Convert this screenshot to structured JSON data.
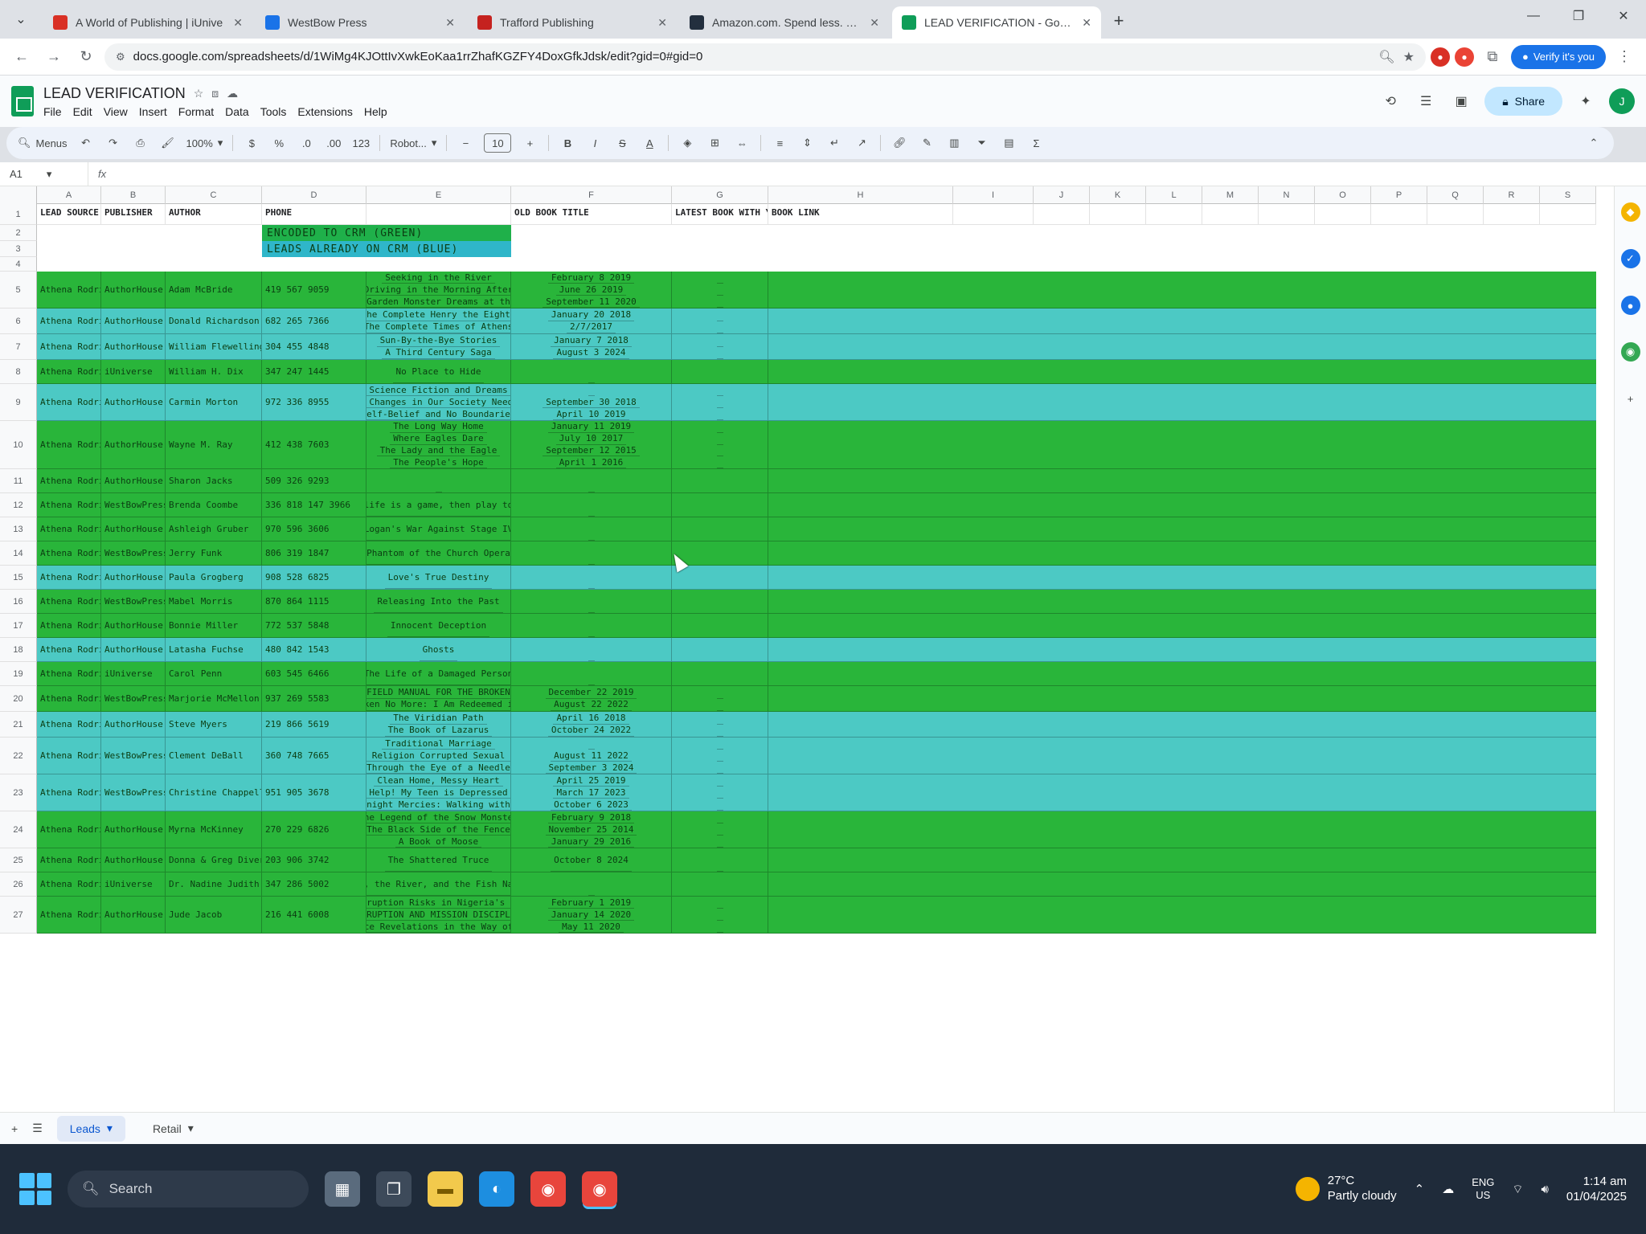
{
  "browser": {
    "tabs": [
      {
        "title": "A World of Publishing | iUnive",
        "icon": "iuniverse-favicon",
        "color": "#d93025",
        "active": false
      },
      {
        "title": "WestBow Press",
        "icon": "westbow-favicon",
        "color": "#1a73e8",
        "active": false
      },
      {
        "title": "Trafford Publishing",
        "icon": "trafford-favicon",
        "color": "#c5221f",
        "active": false
      },
      {
        "title": "Amazon.com. Spend less. Smi",
        "icon": "amazon-favicon",
        "color": "#232f3e",
        "active": false
      },
      {
        "title": "LEAD VERIFICATION - Google",
        "icon": "sheets-favicon",
        "color": "#0f9d58",
        "active": true
      }
    ],
    "url": "docs.google.com/spreadsheets/d/1WiMg4KJOttIvXwkEoKaa1rrZhafKGZFY4DoxGfkJdsk/edit?gid=0#gid=0",
    "verify_label": "Verify it's you"
  },
  "sheets": {
    "doc_title": "LEAD VERIFICATION",
    "menu": [
      "File",
      "Edit",
      "View",
      "Insert",
      "Format",
      "Data",
      "Tools",
      "Extensions",
      "Help"
    ],
    "share_label": "Share",
    "avatar_letter": "J"
  },
  "toolbar": {
    "search": "Menus",
    "zoom": "100%",
    "currency": "$",
    "percent": "%",
    "decimal_dec": ".0",
    "decimal_inc": ".00",
    "format_123": "123",
    "font": "Robot...",
    "font_size": "10"
  },
  "formula_bar": {
    "cell_ref": "A1",
    "fx": "fx"
  },
  "grid": {
    "column_letters": [
      "A",
      "B",
      "C",
      "D",
      "E",
      "F",
      "G",
      "H",
      "I",
      "J",
      "K",
      "L",
      "M",
      "N",
      "O",
      "P",
      "Q",
      "R",
      "S"
    ],
    "headers": {
      "lead_source": "LEAD SOURCE",
      "publisher": "PUBLISHER",
      "author": "AUTHOR",
      "phone": "PHONE",
      "old_book_title": "OLD BOOK TITLE",
      "latest_book": "LATEST BOOK WITH YEAR",
      "book_link": "BOOK LINK"
    },
    "legend": [
      "ENCODED TO CRM (GREEN)",
      "LEADS ALREADY ON CRM (BLUE)"
    ],
    "colors": {
      "green": "#29b53a",
      "blue": "#4cc9c4",
      "legend_green": "#1fb04a",
      "legend_blue": "#2fb6c9"
    },
    "rows": [
      {
        "source": "Athena Rodrigu",
        "publisher": "AuthorHouse",
        "author": "Adam McBride",
        "phone": "419 567 9059",
        "color": "green",
        "titles": [
          "Seeking in the River",
          "Driving in the Morning After",
          "The Garden Monster Dreams at the Fa"
        ],
        "dates": [
          "February 8 2019",
          "June 26 2019",
          "September 11 2020"
        ],
        "links": 3
      },
      {
        "source": "Athena Rodrigu",
        "publisher": "AuthorHouse",
        "author": "Donald Richardson",
        "phone": "682 265 7366",
        "color": "blue",
        "titles": [
          "The Complete Henry the Eighth",
          "The Complete Times of Athens"
        ],
        "dates": [
          "January 20 2018",
          "2/7/2017"
        ],
        "links": 2
      },
      {
        "source": "Athena Rodrigu",
        "publisher": "AuthorHouse",
        "author": "William Flewelling",
        "phone": "304 455 4848",
        "color": "blue",
        "titles": [
          "Sun-By-the-Bye Stories",
          "A Third Century Saga"
        ],
        "dates": [
          "January 7 2018",
          "August 3 2024"
        ],
        "links": 2
      },
      {
        "source": "Athena Rodrigu",
        "publisher": "iUniverse",
        "author": "William H. Dix",
        "phone": "347 247 1445",
        "color": "green",
        "titles": [
          "No Place to Hide"
        ],
        "dates": [
          ""
        ],
        "links": 0
      },
      {
        "source": "Athena Rodrigu",
        "publisher": "AuthorHouse",
        "author": "Carmin Morton",
        "phone": "972 336 8955",
        "color": "blue",
        "titles": [
          "Science Fiction and Dreams",
          "The Changes in Our Society Need Ju",
          "Self-Belief and No Boundaries"
        ],
        "dates": [
          "",
          "September 30 2018",
          "April 10 2019"
        ],
        "links": 3
      },
      {
        "source": "Athena Rodrigu",
        "publisher": "AuthorHouse",
        "author": "Wayne M. Ray",
        "phone": "412 438 7603",
        "color": "green",
        "titles": [
          "The Long Way Home",
          "Where Eagles Dare",
          "The Lady and the Eagle",
          "The People's Hope"
        ],
        "dates": [
          "January 11 2019",
          "July 10 2017",
          "September 12 2015",
          "April 1 2016"
        ],
        "links": 4
      },
      {
        "source": "Athena Rodrigu",
        "publisher": "AuthorHouse",
        "author": "Sharon Jacks",
        "phone": "509 326 9293",
        "color": "green",
        "titles": [
          ""
        ],
        "dates": [
          ""
        ],
        "links": 0
      },
      {
        "source": "Athena Rodrigu",
        "publisher": "WestBowPress",
        "author": "Brenda Coombe",
        "phone": "336 818 147 3966",
        "color": "green",
        "titles": [
          "If life is a game, then play to wi"
        ],
        "dates": [
          ""
        ],
        "links": 0
      },
      {
        "source": "Athena Rodrigu",
        "publisher": "AuthorHouse",
        "author": "Ashleigh Gruber",
        "phone": "970 596 3606",
        "color": "green",
        "titles": [
          "Logan's War Against Stage IV"
        ],
        "dates": [
          ""
        ],
        "links": 0
      },
      {
        "source": "Athena Rodrigu",
        "publisher": "WestBowPress",
        "author": "Jerry Funk",
        "phone": "806 319 1847",
        "color": "green",
        "titles": [
          "Phantom of the Church Opera"
        ],
        "dates": [
          ""
        ],
        "links": 0
      },
      {
        "source": "Athena Rodrigu",
        "publisher": "AuthorHouse",
        "author": "Paula Grogberg",
        "phone": "908 528 6825",
        "color": "blue",
        "titles": [
          "Love's True Destiny"
        ],
        "dates": [
          ""
        ],
        "links": 0
      },
      {
        "source": "Athena Rodrigu",
        "publisher": "WestBowPress",
        "author": "Mabel Morris",
        "phone": "870 864 1115",
        "color": "green",
        "titles": [
          "Releasing Into the Past"
        ],
        "dates": [
          ""
        ],
        "links": 0
      },
      {
        "source": "Athena Rodrigu",
        "publisher": "AuthorHouse",
        "author": "Bonnie Miller",
        "phone": "772 537 5848",
        "color": "green",
        "titles": [
          "Innocent Deception"
        ],
        "dates": [
          ""
        ],
        "links": 0
      },
      {
        "source": "Athena Rodrigu",
        "publisher": "AuthorHouse",
        "author": "Latasha Fuchse",
        "phone": "480 842 1543",
        "color": "blue",
        "titles": [
          "Ghosts"
        ],
        "dates": [
          ""
        ],
        "links": 0
      },
      {
        "source": "Athena Rodrigu",
        "publisher": "iUniverse",
        "author": "Carol Penn",
        "phone": "603 545 6466",
        "color": "green",
        "titles": [
          "The Life of a Damaged Person"
        ],
        "dates": [
          ""
        ],
        "links": 0
      },
      {
        "source": "Athena Rodrigu",
        "publisher": "WestBowPress",
        "author": "Marjorie McMellon",
        "phone": "937 269 5583",
        "color": "green",
        "titles": [
          "FIELD MANUAL FOR THE BROKEN",
          "Broken No More: I Am Redeemed in C"
        ],
        "dates": [
          "December 22 2019",
          "August 22 2022"
        ],
        "links": 2
      },
      {
        "source": "Athena Rodrigu",
        "publisher": "AuthorHouse",
        "author": "Steve Myers",
        "phone": "219 866 5619",
        "color": "blue",
        "titles": [
          "The Viridian Path",
          "The Book of Lazarus"
        ],
        "dates": [
          "April 16 2018",
          "October 24 2022"
        ],
        "links": 2
      },
      {
        "source": "Athena Rodrigu",
        "publisher": "WestBowPress",
        "author": "Clement DeBall",
        "phone": "360 748 7665",
        "color": "blue",
        "titles": [
          "Traditional Marriage",
          "How Religion Corrupted Sexual Eth",
          "Through the Eye of a Needle"
        ],
        "dates": [
          "",
          "August 11 2022",
          "September 3 2024"
        ],
        "links": 3
      },
      {
        "source": "Athena Rodrigu",
        "publisher": "WestBowPress",
        "author": "Christine Chappell",
        "phone": "951 905 3678",
        "color": "blue",
        "titles": [
          "Clean Home, Messy Heart",
          "Help! My Teen is Depressed",
          "Midnight Mercies: Walking with Go"
        ],
        "dates": [
          "April 25 2019",
          "March 17 2023",
          "October 6 2023"
        ],
        "links": 3
      },
      {
        "source": "Athena Rodrigu",
        "publisher": "AuthorHouse",
        "author": "Myrna McKinney",
        "phone": "270 229 6826",
        "color": "green",
        "titles": [
          "The Legend of the Snow Monster",
          "The Black Side of the Fence",
          "A Book of Moose"
        ],
        "dates": [
          "February 9 2018",
          "November 25 2014",
          "January 29 2016"
        ],
        "links": 3
      },
      {
        "source": "Athena Rodrigu",
        "publisher": "AuthorHouse",
        "author": "Donna & Greg Diver",
        "phone": "203 906 3742",
        "color": "green",
        "titles": [
          "The Shattered Truce"
        ],
        "dates": [
          "October 8 2024"
        ],
        "links": 1
      },
      {
        "source": "Athena Rodrigu",
        "publisher": "iUniverse",
        "author": "Dr. Nadine Judith Lynch",
        "phone": "347 286 5002",
        "color": "green",
        "titles": [
          "The Boy, the River, and the Fish Named Zed"
        ],
        "dates": [
          ""
        ],
        "links": 0
      },
      {
        "source": "Athena Rodrigu",
        "publisher": "AuthorHouse",
        "author": "Jude Jacob",
        "phone": "216 441 6008",
        "color": "green",
        "titles": [
          "Corruption Risks in Nigeria's Def",
          "CORRUPTION AND MISSION DISCIPLINE",
          "Grace Revelations in the Way of Li"
        ],
        "dates": [
          "February 1 2019",
          "January 14 2020",
          "May 11 2020"
        ],
        "links": 3
      }
    ]
  },
  "sheet_tabs": {
    "add": "+",
    "all_sheets": "☰",
    "active_tab": "Leads",
    "other_tab": "Retail"
  },
  "taskbar": {
    "search_placeholder": "Search",
    "weather_temp": "27°C",
    "weather_desc": "Partly cloudy",
    "lang_top": "ENG",
    "lang_bottom": "US",
    "time": "1:14 am",
    "date": "01/04/2025"
  }
}
